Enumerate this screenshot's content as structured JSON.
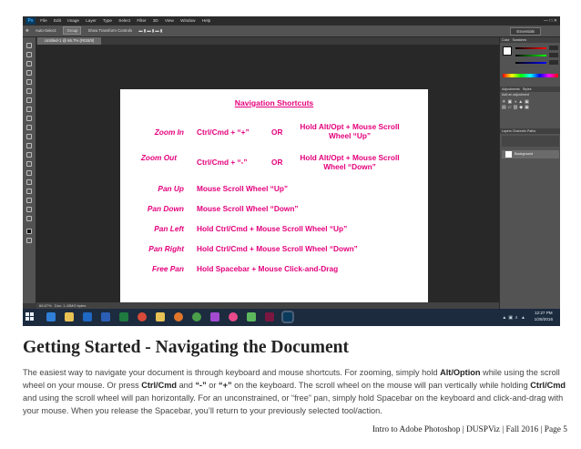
{
  "screenshot": {
    "app_logo": "Ps",
    "menu": [
      "File",
      "Edit",
      "Image",
      "Layer",
      "Type",
      "Select",
      "Filter",
      "3D",
      "View",
      "Window",
      "Help"
    ],
    "options_bar": {
      "auto_select": "Auto-Select:",
      "group_value": "Group",
      "show_transform": "Show Transform Controls",
      "workspace": "Essentials"
    },
    "doc_tab": "Untitled-1 @ 66.7% (RGB/8)",
    "status_zoom": "66.67%",
    "status_doc": "Doc: 1.43M/0 bytes",
    "panels": {
      "color_tab": "Color",
      "swatches_tab": "Swatches",
      "adjustments_tab": "Adjustments",
      "styles_tab": "Styles",
      "add_adjustment": "Add an adjustment",
      "layers_tab": "Layers",
      "channels_tab": "Channels",
      "paths_tab": "Paths",
      "layer_name": "Background"
    },
    "canvas": {
      "title": "Navigation Shortcuts",
      "rows": [
        {
          "label": "Zoom In",
          "desc": "Ctrl/Cmd + “+”",
          "or": "OR",
          "alt": "Hold Alt/Opt + Mouse Scroll Wheel “Up”"
        },
        {
          "label": "Zoom Out",
          "desc": "Ctrl/Cmd + “-”",
          "or": "OR",
          "alt": "Hold Alt/Opt + Mouse Scroll Wheel “Down”"
        },
        {
          "label": "Pan Up",
          "desc": "Mouse Scroll Wheel “Up”"
        },
        {
          "label": "Pan Down",
          "desc": "Mouse Scroll Wheel “Down”"
        },
        {
          "label": "Pan Left",
          "desc": "Hold Ctrl/Cmd + Mouse Scroll Wheel “Up”"
        },
        {
          "label": "Pan Right",
          "desc": "Hold Ctrl/Cmd + Mouse Scroll Wheel “Down”"
        },
        {
          "label": "Free Pan",
          "desc": "Hold Spacebar + Mouse Click-and-Drag"
        }
      ]
    },
    "taskbar": {
      "time": "12:27 PM",
      "date": "1/25/2016",
      "icon_names": [
        "start-icon",
        "ie-icon",
        "explorer-icon",
        "outlook-icon",
        "word-icon",
        "excel-icon",
        "chrome-icon",
        "folder-icon",
        "firefox-icon",
        "chrome2-icon",
        "media-icon",
        "itunes-icon",
        "notes-icon",
        "indesign-icon",
        "photoshop-icon"
      ]
    }
  },
  "heading": "Getting Started - Navigating the Document",
  "paragraph": {
    "t1": "The easiest way to navigate your document is through keyboard and mouse shortcuts. For zooming, simply hold ",
    "b1": "Alt/Option",
    "t2": " while using the scroll wheel on your mouse. Or press ",
    "b2": "Ctrl/Cmd",
    "t3": " and ",
    "b3": "“-”",
    "t4": " or ",
    "b4": "“+”",
    "t5": " on the keyboard. The scroll wheel on the mouse will pan vertically while holding ",
    "b5": "Ctrl/Cmd",
    "t6": " and using the scroll wheel will pan horizontally. For an unconstrained, or “free” pan, simply hold Spacebar on the keyboard and click-and-drag with your mouse. When you release the Spacebar, you’ll return to your previously selected tool/action."
  },
  "footer": "Intro to Adobe Photoshop | DUSPViz | Fall 2016 | Page 5"
}
